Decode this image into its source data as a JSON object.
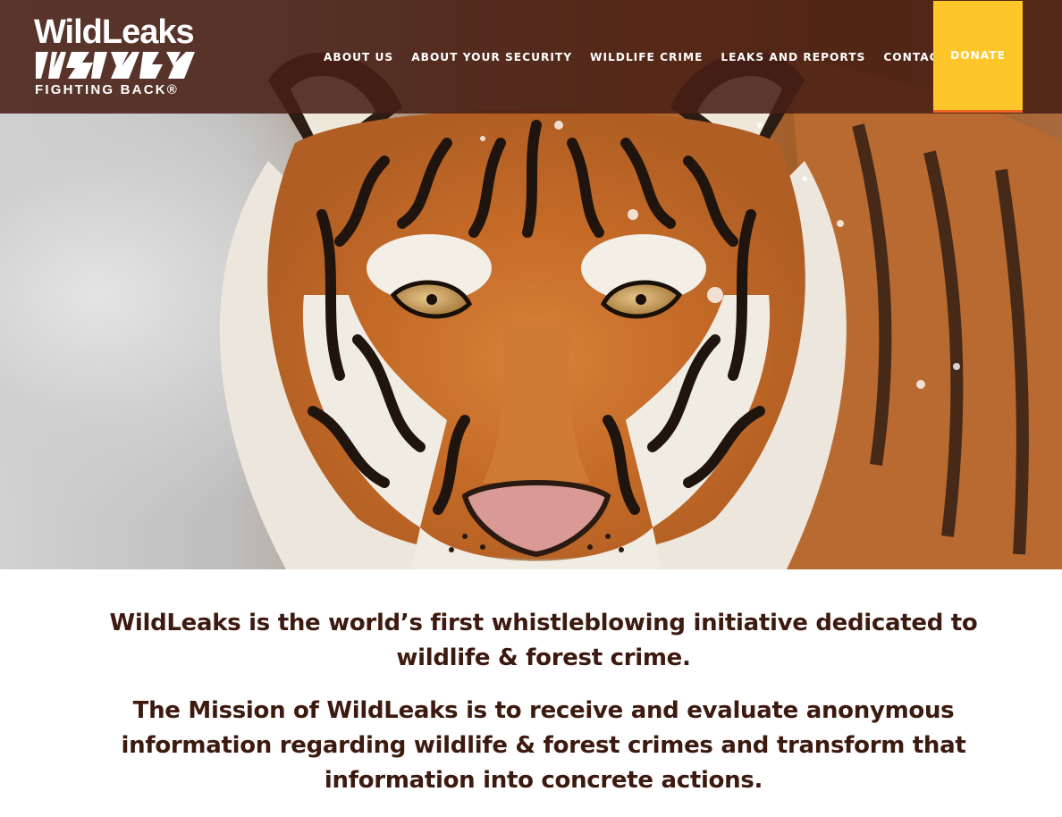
{
  "logo": {
    "wordmark": "WildLeaks",
    "tagline": "FIGHTING BACK®"
  },
  "nav": {
    "items": [
      {
        "label": "ABOUT US"
      },
      {
        "label": "ABOUT YOUR SECURITY"
      },
      {
        "label": "WILDLIFE CRIME"
      },
      {
        "label": "LEAKS AND REPORTS"
      },
      {
        "label": "CONTACT"
      }
    ],
    "donate_label": "DONATE"
  },
  "hero": {
    "image": "tiger-face-in-snow-photo"
  },
  "mission": {
    "intro": "WildLeaks is the world’s first whistleblowing initiative dedicated to wildlife & forest crime.",
    "statement": "The Mission of WildLeaks is to receive and evaluate anonymous information regarding wildlife & forest crimes and transform that information into concrete actions."
  },
  "colors": {
    "header_bg": "#481f14",
    "donate_bg": "#ffc629",
    "donate_border": "#f26522",
    "mission_text": "#3d1a10",
    "tiger_orange": "#c8702c"
  }
}
